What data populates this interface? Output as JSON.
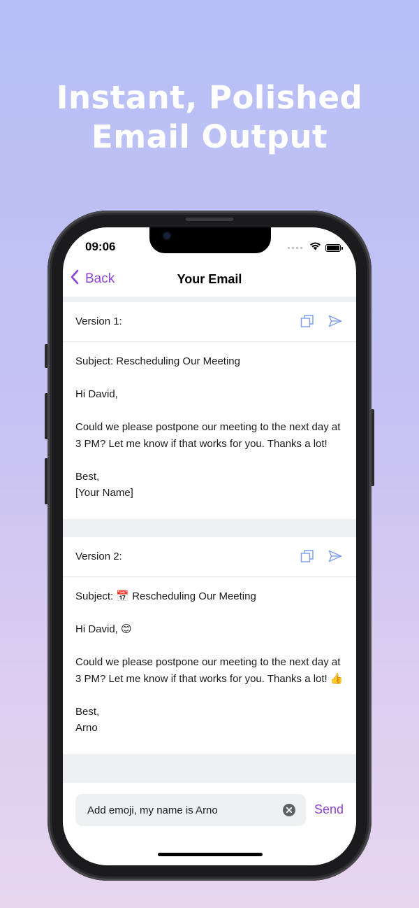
{
  "headline": {
    "line1": "Instant, Polished",
    "line2": "Email Output"
  },
  "status_bar": {
    "time": "09:06"
  },
  "nav": {
    "back_label": "Back",
    "title": "Your Email"
  },
  "versions": [
    {
      "label": "Version 1:",
      "subject": "Subject: Rescheduling Our Meeting",
      "greeting": "Hi David,",
      "body": "Could we please postpone our meeting to the next day at 3 PM? Let me know if that works for you. Thanks a lot!",
      "signoff": "Best,",
      "signature": "[Your Name]"
    },
    {
      "label": "Version 2:",
      "subject": "Subject: 📅 Rescheduling Our Meeting",
      "greeting": "Hi David, 😊",
      "body": "Could we please postpone our meeting to the next day at 3 PM? Let me know if that works for you. Thanks a lot! 👍",
      "signoff": "Best,",
      "signature": "Arno"
    }
  ],
  "composer": {
    "input_value": "Add emoji, my name is Arno",
    "send_label": "Send"
  },
  "colors": {
    "accent": "#8e44d2",
    "icon_blue": "#7b9cf0"
  }
}
